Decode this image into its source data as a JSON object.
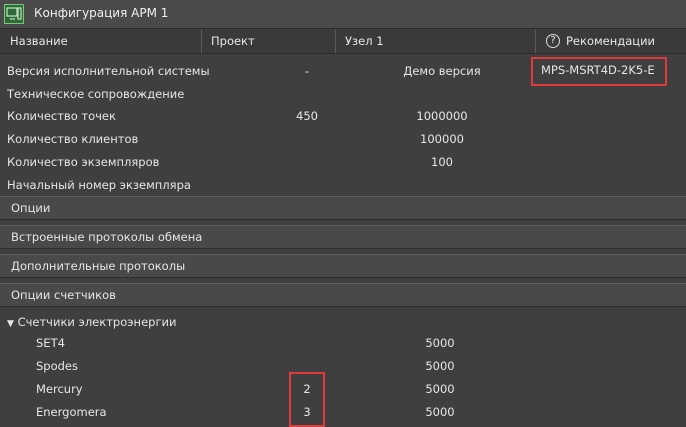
{
  "window": {
    "title": "Конфигурация АРМ 1",
    "icon": "workstation-icon"
  },
  "columns": {
    "name": "Название",
    "project": "Проект",
    "node": "Узел 1",
    "recommendations": "Рекомендации",
    "help_icon": "?"
  },
  "rows": [
    {
      "label": "Версия исполнительной системы",
      "project": "-",
      "node": "Демо версия",
      "recommendation": "MPS-MSRT4D-2K5-E"
    },
    {
      "label": "Техническое сопровождение"
    },
    {
      "label": "Количество точек",
      "project": "450",
      "node": "1000000"
    },
    {
      "label": "Количество клиентов",
      "node": "100000"
    },
    {
      "label": "Количество экземпляров",
      "node": "100"
    },
    {
      "label": "Начальный номер экземпляра"
    }
  ],
  "sections": [
    {
      "label": "Опции"
    },
    {
      "label": "Встроенные протоколы обмена"
    },
    {
      "label": "Дополнительные протоколы"
    },
    {
      "label": "Опции счетчиков"
    }
  ],
  "meters": {
    "group_label": "Счетчики электроэнергии",
    "expand_symbol": "▼",
    "items": [
      {
        "name": "SET4",
        "project": "",
        "node": "5000"
      },
      {
        "name": "Spodes",
        "project": "",
        "node": "5000"
      },
      {
        "name": "Mercury",
        "project": "2",
        "node": "5000"
      },
      {
        "name": "Energomera",
        "project": "3",
        "node": "5000"
      }
    ]
  },
  "colors": {
    "highlight": "#e03b3b",
    "background": "#3f3f3f",
    "section": "#494949"
  }
}
